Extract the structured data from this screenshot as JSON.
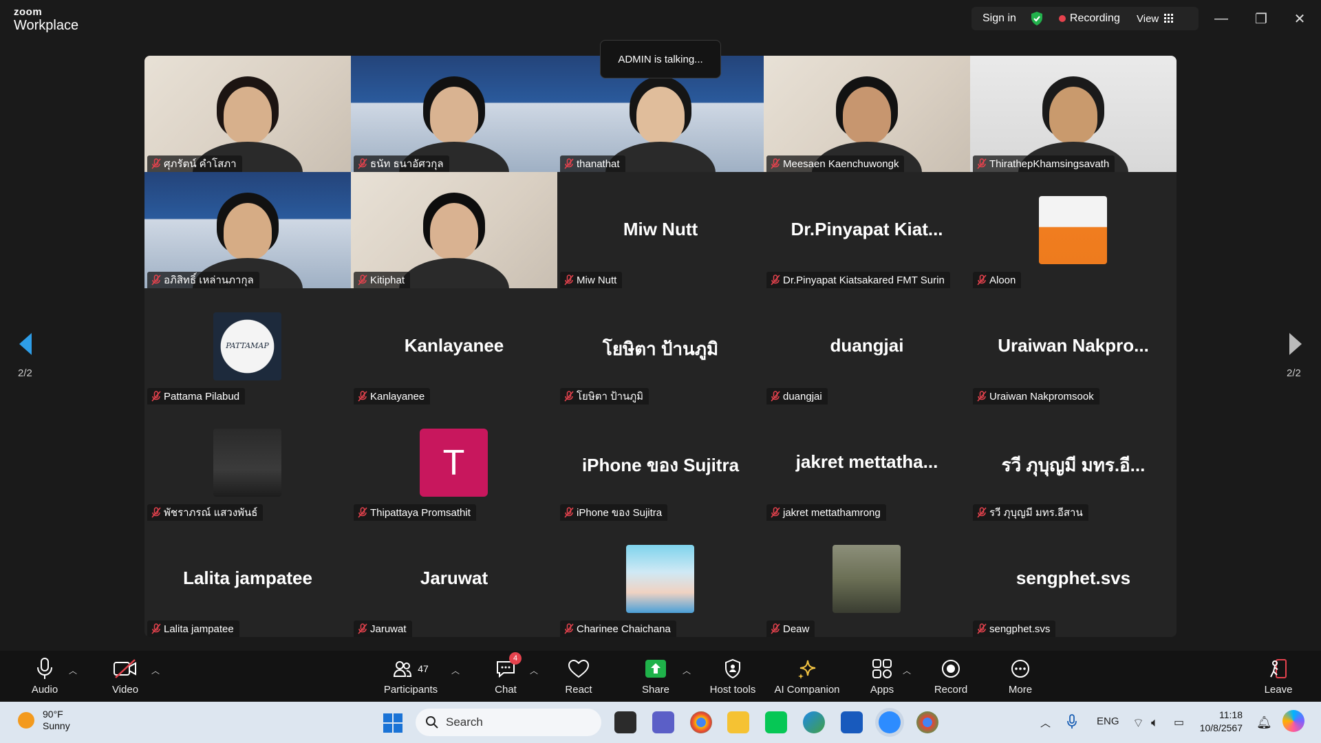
{
  "app": {
    "logo_top": "zoom",
    "logo_bottom": "Workplace"
  },
  "titlebar": {
    "sign_in": "Sign in",
    "recording": "Recording",
    "view": "View",
    "minimize": "—",
    "restore": "❐",
    "close": "✕"
  },
  "toast": "ADMIN is talking...",
  "nav": {
    "page_left": "2/2",
    "page_right": "2/2"
  },
  "tiles": [
    {
      "name": "ศุภรัตน์  คำโสภา",
      "type": "video"
    },
    {
      "name": "ธนัท ธนาอัศวกุล",
      "type": "video"
    },
    {
      "name": "thanathat",
      "type": "video"
    },
    {
      "name": "Meesaen Kaenchuwongk",
      "type": "video"
    },
    {
      "name": "ThirathepKhamsingsavath",
      "type": "video"
    },
    {
      "name": "อภิสิทธิ์ เหล่านภากุล",
      "type": "video"
    },
    {
      "name": "Kitiphat",
      "type": "video"
    },
    {
      "name": "Miw Nutt",
      "display": "Miw Nutt",
      "type": "name"
    },
    {
      "name": "Dr.Pinyapat Kiatsakared FMT Surin",
      "display": "Dr.Pinyapat  Kiat...",
      "type": "name"
    },
    {
      "name": "Aloon",
      "type": "photo"
    },
    {
      "name": "Pattama Pilabud",
      "type": "photo",
      "photo_text": "PATTAMAP"
    },
    {
      "name": "Kanlayanee",
      "display": "Kanlayanee",
      "type": "name"
    },
    {
      "name": "โยษิตา ป้านภูมิ",
      "display": "โยษิตา ป้านภูมิ",
      "type": "name"
    },
    {
      "name": "duangjai",
      "display": "duangjai",
      "type": "name"
    },
    {
      "name": "Uraiwan Nakpromsook",
      "display": "Uraiwan  Nakpro...",
      "type": "name"
    },
    {
      "name": "พัชราภรณ์ แสวงพันธ์",
      "type": "photo"
    },
    {
      "name": "Thipattaya Promsathit",
      "type": "initial",
      "initial": "T"
    },
    {
      "name": "iPhone ของ Sujitra",
      "display": "iPhone ของ Sujitra",
      "type": "name"
    },
    {
      "name": "jakret mettathamrong",
      "display": "jakret  mettatha...",
      "type": "name"
    },
    {
      "name": "รวี ภุบุญมี มทร.อีสาน",
      "display": "รวี ภุบุญมี มทร.อี...",
      "type": "name"
    },
    {
      "name": "Lalita jampatee",
      "display": "Lalita jampatee",
      "type": "name"
    },
    {
      "name": "Jaruwat",
      "display": "Jaruwat",
      "type": "name"
    },
    {
      "name": "Charinee  Chaichana",
      "type": "photo"
    },
    {
      "name": "Deaw",
      "type": "photo"
    },
    {
      "name": "sengphet.svs",
      "display": "sengphet.svs",
      "type": "name"
    }
  ],
  "toolbar": {
    "audio": "Audio",
    "video": "Video",
    "participants": "Participants",
    "participants_count": "47",
    "chat": "Chat",
    "chat_badge": "4",
    "react": "React",
    "share": "Share",
    "host_tools": "Host tools",
    "ai_companion": "AI Companion",
    "apps": "Apps",
    "record": "Record",
    "more": "More",
    "leave": "Leave"
  },
  "taskbar": {
    "temp": "90°F",
    "condition": "Sunny",
    "search": "Search",
    "lang": "ENG",
    "time": "11:18",
    "date": "10/8/2567"
  }
}
